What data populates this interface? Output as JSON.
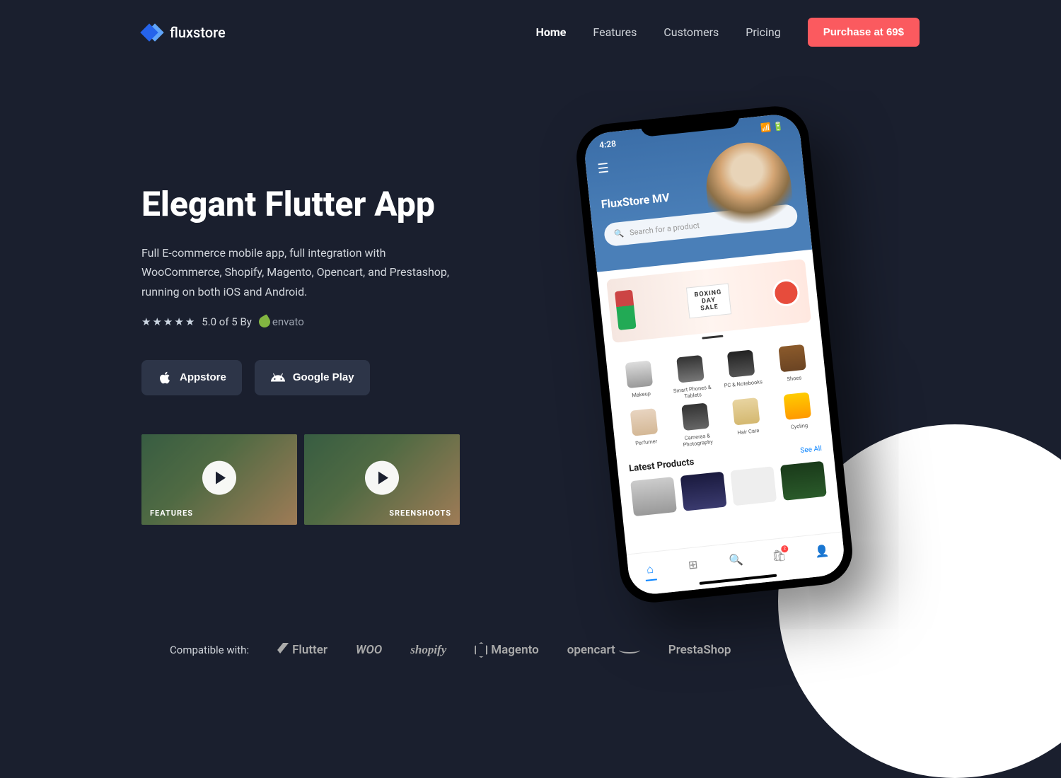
{
  "brand": "fluxstore",
  "nav": {
    "items": [
      "Home",
      "Features",
      "Customers",
      "Pricing"
    ],
    "active": "Home",
    "purchase": "Purchase at 69$"
  },
  "hero": {
    "title": "Elegant Flutter App",
    "description": "Full E-commerce mobile app, full integration with WooCommerce, Shopify, Magento, Opencart, and Prestashop, running on both iOS and Android.",
    "rating": "5.0 of 5 By",
    "ratingBrand": "envato",
    "appstore": "Appstore",
    "googleplay": "Google Play"
  },
  "videos": {
    "features": "FEATURES",
    "screenshots": "SREENSHOOTS"
  },
  "phone": {
    "time": "4:28",
    "brand": "FluxStore MV",
    "searchPlaceholder": "Search for a product",
    "banner": {
      "line1": "BOXING",
      "line2": "DAY",
      "line3": "SALE"
    },
    "categories": [
      {
        "label": "Makeup"
      },
      {
        "label": "Smart Phones & Tablets"
      },
      {
        "label": "PC & Notebooks"
      },
      {
        "label": "Shoes"
      },
      {
        "label": "Perfumer"
      },
      {
        "label": "Cameras & Photography"
      },
      {
        "label": "Hair Care"
      },
      {
        "label": "Cycling"
      }
    ],
    "sectionTitle": "Latest Products",
    "seeAll": "See All",
    "cartBadge": "2"
  },
  "compat": {
    "label": "Compatible with:",
    "flutter": "Flutter",
    "woo": "WOO",
    "shopify": "shopify",
    "magento": "Magento",
    "opencart": "opencart",
    "prestashop": "PrestaShop"
  }
}
